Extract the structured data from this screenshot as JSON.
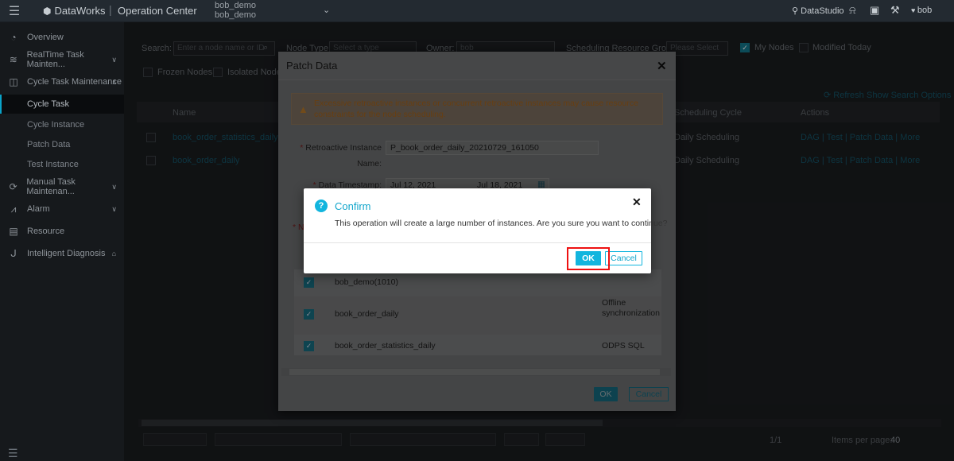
{
  "topbar": {
    "brand": "DataWorks",
    "separator": "|",
    "title": "Operation Center",
    "workspace_line1": "bob_demo",
    "workspace_line2": "bob_demo",
    "datastudio": "DataStudio",
    "user": "bob"
  },
  "sidebar": {
    "items": [
      {
        "label": "Overview",
        "icon": "pie-chart-icon"
      },
      {
        "label": "RealTime Task Mainten...",
        "icon": "realtime-icon"
      },
      {
        "label": "Cycle Task Maintenance",
        "icon": "cycle-icon"
      },
      {
        "label": "Manual Task Maintenan...",
        "icon": "manual-icon"
      },
      {
        "label": "Alarm",
        "icon": "alarm-icon"
      },
      {
        "label": "Resource",
        "icon": "resource-icon"
      },
      {
        "label": "Intelligent Diagnosis",
        "icon": "diagnosis-icon"
      }
    ],
    "sub_items": [
      "Cycle Task",
      "Cycle Instance",
      "Patch Data",
      "Test Instance"
    ]
  },
  "main": {
    "search_label": "Search:",
    "search_placeholder": "Enter a node name or ID",
    "node_type_label": "Node Type:",
    "node_type_placeholder": "Select a type",
    "owner_label": "Owner:",
    "owner_value": "bob",
    "resource_group_label": "Scheduling Resource Group:",
    "resource_group_placeholder": "Please Select",
    "my_nodes": "My Nodes",
    "modified_today": "Modified Today",
    "frozen_nodes": "Frozen Nodes",
    "isolated_nodes": "Isolated Nodes",
    "refresh": "Refresh",
    "show_search_options": "Show Search Options",
    "col_name": "Name",
    "col_cycle": "Scheduling Cycle",
    "col_actions": "Actions",
    "rows": [
      {
        "name": "book_order_statistics_daily",
        "cycle": "Daily Scheduling"
      },
      {
        "name": "book_order_daily",
        "cycle": "Daily Scheduling"
      }
    ],
    "actions": {
      "dag": "DAG",
      "test": "Test",
      "patch": "Patch Data",
      "more": "More"
    },
    "pager": {
      "page": "1/1",
      "items_label": "Items per page:",
      "items_value": "40"
    }
  },
  "patch": {
    "title": "Patch Data",
    "warning": "Excessive retroactive instances or concurrent retroactive instances may cause resource constraints for the node scheduling.",
    "instance_name_label": "Retroactive Instance",
    "instance_name_label2": "Name:",
    "instance_name_value": "P_book_order_daily_20210729_161050",
    "timestamp_label": "Data Timestamp:",
    "date_start": "Jul 12, 2021",
    "date_end": "Jul 18, 2021",
    "rows": [
      {
        "name": "bob_demo(1010)",
        "type": ""
      },
      {
        "name": "book_order_daily",
        "type": "Offline synchronization"
      },
      {
        "name": "book_order_statistics_daily",
        "type": "ODPS SQL"
      }
    ],
    "ok": "OK",
    "cancel": "Cancel"
  },
  "confirm": {
    "title": "Confirm",
    "message": "This operation will create a large number of instances. Are you sure you want to continue?",
    "ok": "OK",
    "cancel": "Cancel"
  },
  "colors": {
    "accent": "#12b5de",
    "highlight": "#ee1111",
    "warning": "#a8641b"
  }
}
